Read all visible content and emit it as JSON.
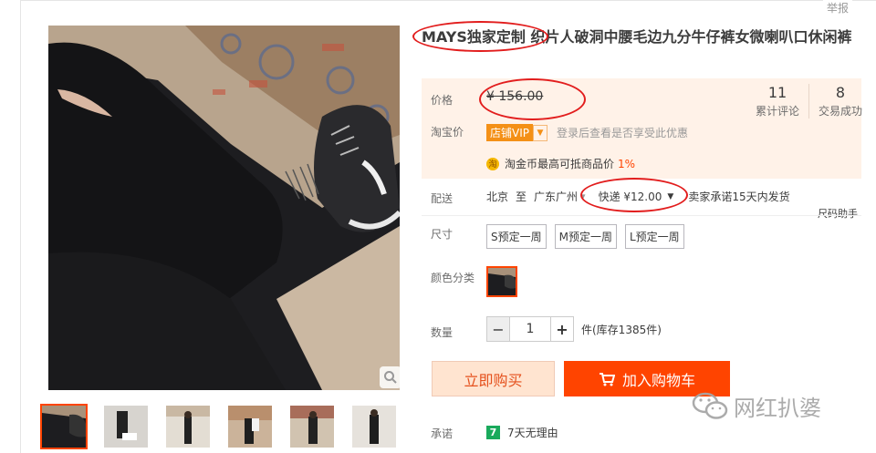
{
  "report_label": "举报",
  "product": {
    "title": "MAYS独家定制 织片人破洞中腰毛边九分牛仔裤女微喇叭口休闲裤"
  },
  "price": {
    "label": "价格",
    "value": "¥ 156.00"
  },
  "stats": [
    {
      "num": "11",
      "label": "累计评论"
    },
    {
      "num": "8",
      "label": "交易成功"
    }
  ],
  "taobao_price": {
    "label": "淘宝价",
    "vip_badge": "店铺VIP",
    "hint": "登录后查看是否享受此优惠"
  },
  "coin": {
    "icon_text": "淘",
    "text": "淘金币最高可抵商品价",
    "percent": "1%"
  },
  "shipping": {
    "label": "配送",
    "from": "北京",
    "to_word": "至",
    "dest": "广东广州",
    "method": "快递 ¥12.00",
    "promise": "卖家承诺15天内发货",
    "size_helper": "尺码助手"
  },
  "size": {
    "label": "尺寸",
    "options": [
      "S预定一周",
      "M预定一周",
      "L预定一周"
    ]
  },
  "color": {
    "label": "颜色分类"
  },
  "quantity": {
    "label": "数量",
    "value": "1",
    "minus": "−",
    "plus": "+",
    "stock": "件(库存1385件)"
  },
  "buttons": {
    "buy_now": "立即购买",
    "add_cart": "加入购物车"
  },
  "guarantee": {
    "label": "承诺",
    "badge": "7",
    "text": "7天无理由"
  },
  "watermark": "网红扒婆",
  "colors": {
    "accent": "#ff4400",
    "annotation": "#e21d1d",
    "pricebox_bg": "#fff2e8"
  }
}
